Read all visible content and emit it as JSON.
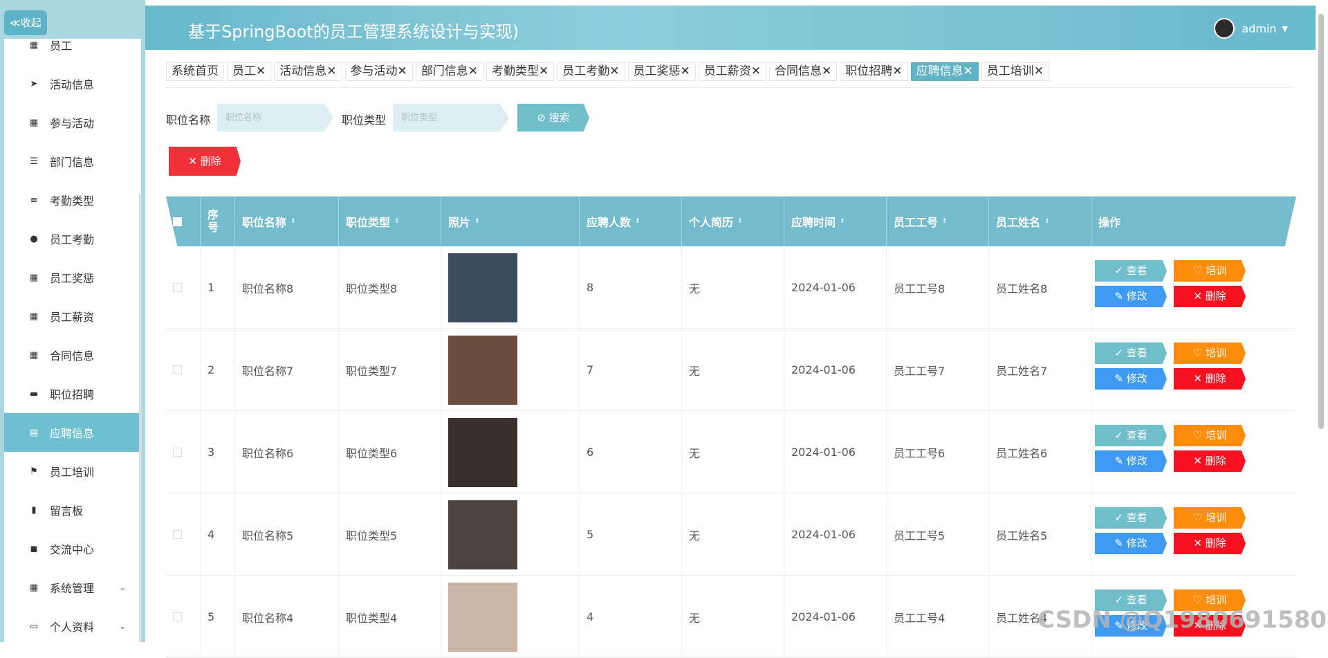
{
  "sidebar": {
    "collapse_label": "≪收起",
    "items": [
      {
        "label": "员工",
        "icon": "grid-icon"
      },
      {
        "label": "活动信息",
        "icon": "send-icon"
      },
      {
        "label": "参与活动",
        "icon": "grid-icon"
      },
      {
        "label": "部门信息",
        "icon": "sliders-icon"
      },
      {
        "label": "考勤类型",
        "icon": "list-icon"
      },
      {
        "label": "员工考勤",
        "icon": "user-icon"
      },
      {
        "label": "员工奖惩",
        "icon": "grid-icon"
      },
      {
        "label": "员工薪资",
        "icon": "grid-icon"
      },
      {
        "label": "合同信息",
        "icon": "grid-icon"
      },
      {
        "label": "职位招聘",
        "icon": "monitor-icon"
      },
      {
        "label": "应聘信息",
        "icon": "clipboard-icon",
        "active": true
      },
      {
        "label": "员工培训",
        "icon": "flag-icon"
      },
      {
        "label": "留言板",
        "icon": "phone-icon"
      },
      {
        "label": "交流中心",
        "icon": "video-icon"
      },
      {
        "label": "系统管理",
        "icon": "grid-icon",
        "expandable": true
      },
      {
        "label": "个人资料",
        "icon": "card-icon",
        "expandable": true
      }
    ]
  },
  "header": {
    "title": "基于SpringBoot的员工管理系统设计与实现)",
    "user": "admin"
  },
  "tabs": [
    {
      "label": "系统首页"
    },
    {
      "label": "员工✕"
    },
    {
      "label": "活动信息✕"
    },
    {
      "label": "参与活动✕"
    },
    {
      "label": "部门信息✕"
    },
    {
      "label": "考勤类型✕"
    },
    {
      "label": "员工考勤✕"
    },
    {
      "label": "员工奖惩✕"
    },
    {
      "label": "员工薪资✕"
    },
    {
      "label": "合同信息✕"
    },
    {
      "label": "职位招聘✕"
    },
    {
      "label": "应聘信息✕",
      "active": true
    },
    {
      "label": "员工培训✕"
    }
  ],
  "search": {
    "name_label": "职位名称",
    "name_placeholder": "职位名称",
    "type_label": "职位类型",
    "type_placeholder": "职位类型",
    "search_button": "搜索",
    "delete_button": "删除"
  },
  "table": {
    "headers": [
      "序号",
      "职位名称",
      "职位类型",
      "照片",
      "应聘人数",
      "个人简历",
      "应聘时间",
      "员工工号",
      "员工姓名",
      "操作"
    ],
    "rows": [
      {
        "no": "1",
        "name": "职位名称8",
        "type": "职位类型8",
        "count": "8",
        "resume": "无",
        "time": "2024-01-06",
        "emp_no": "员工工号8",
        "emp_name": "员工姓名8",
        "photo_color": "#3b4a5e"
      },
      {
        "no": "2",
        "name": "职位名称7",
        "type": "职位类型7",
        "count": "7",
        "resume": "无",
        "time": "2024-01-06",
        "emp_no": "员工工号7",
        "emp_name": "员工姓名7",
        "photo_color": "#6a4d3e"
      },
      {
        "no": "3",
        "name": "职位名称6",
        "type": "职位类型6",
        "count": "6",
        "resume": "无",
        "time": "2024-01-06",
        "emp_no": "员工工号6",
        "emp_name": "员工姓名6",
        "photo_color": "#3a2f2c"
      },
      {
        "no": "4",
        "name": "职位名称5",
        "type": "职位类型5",
        "count": "5",
        "resume": "无",
        "time": "2024-01-06",
        "emp_no": "员工工号5",
        "emp_name": "员工姓名5",
        "photo_color": "#4a4440"
      },
      {
        "no": "5",
        "name": "职位名称4",
        "type": "职位类型4",
        "count": "4",
        "resume": "无",
        "time": "2024-01-06",
        "emp_no": "员工工号4",
        "emp_name": "员工姓名4",
        "photo_color": "#c8b7a6"
      }
    ],
    "actions": {
      "view": "查看",
      "train": "培训",
      "edit": "修改",
      "delete": "删除"
    }
  },
  "watermark": "CSDN @Q1980691580"
}
